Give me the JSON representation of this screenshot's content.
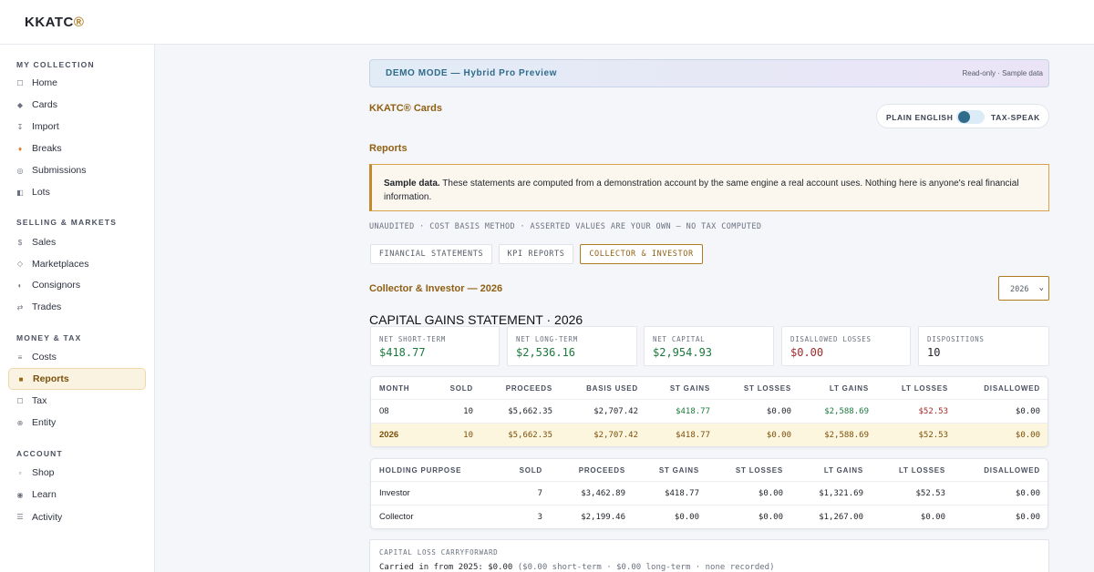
{
  "brand": {
    "name": "KKATC",
    "mark": "®"
  },
  "sidebar": {
    "sections": [
      {
        "title": "MY COLLECTION",
        "items": [
          {
            "label": "Home",
            "icon": "square-outline-icon"
          },
          {
            "label": "Cards",
            "icon": "diamond-icon"
          },
          {
            "label": "Import",
            "icon": "import-icon"
          },
          {
            "label": "Breaks",
            "icon": "flame-icon"
          },
          {
            "label": "Submissions",
            "icon": "target-icon"
          },
          {
            "label": "Lots",
            "icon": "half-square-icon"
          }
        ]
      },
      {
        "title": "SELLING & MARKETS",
        "items": [
          {
            "label": "Sales",
            "icon": "dollar-icon"
          },
          {
            "label": "Marketplaces",
            "icon": "diamond-outline-icon"
          },
          {
            "label": "Consignors",
            "icon": "half-circle-icon"
          },
          {
            "label": "Trades",
            "icon": "swap-icon"
          }
        ]
      },
      {
        "title": "MONEY & TAX",
        "items": [
          {
            "label": "Costs",
            "icon": "lines-icon"
          },
          {
            "label": "Reports",
            "icon": "filled-square-icon",
            "active": true
          },
          {
            "label": "Tax",
            "icon": "box-icon"
          },
          {
            "label": "Entity",
            "icon": "crosshair-icon"
          }
        ]
      },
      {
        "title": "ACCOUNT",
        "items": [
          {
            "label": "Shop",
            "icon": "small-square-icon"
          },
          {
            "label": "Learn",
            "icon": "circle-dot-icon"
          },
          {
            "label": "Activity",
            "icon": "stack-icon"
          }
        ]
      }
    ]
  },
  "demo_banner": {
    "title": "DEMO MODE — Hybrid Pro Preview",
    "right_text": "Read-only · Sample data"
  },
  "brand_title": "KKATC® Cards",
  "toggle": {
    "left_label": "PLAIN ENGLISH",
    "right_label": "TAX-SPEAK",
    "state": "plain-english"
  },
  "reports_title": "Reports",
  "notice": {
    "bold": "Sample data.",
    "text": " These statements are computed from a demonstration account by the same engine a real account uses. Nothing here is anyone's real financial information."
  },
  "methods_line": "UNAUDITED · COST BASIS METHOD · ASSERTED VALUES ARE YOUR OWN — NO TAX COMPUTED",
  "tabs": [
    {
      "label": "FINANCIAL STATEMENTS",
      "active": false
    },
    {
      "label": "KPI REPORTS",
      "active": false
    },
    {
      "label": "COLLECTOR & INVESTOR",
      "active": true
    }
  ],
  "section_title": "Collector & Investor — 2026",
  "year_select": {
    "value": "2026"
  },
  "statement_title": "CAPITAL GAINS STATEMENT · 2026",
  "kpis": [
    {
      "label": "NET SHORT-TERM",
      "value": "$418.77",
      "tone": "gain"
    },
    {
      "label": "NET LONG-TERM",
      "value": "$2,536.16",
      "tone": "gain"
    },
    {
      "label": "NET CAPITAL",
      "value": "$2,954.93",
      "tone": "gain"
    },
    {
      "label": "DISALLOWED LOSSES",
      "value": "$0.00",
      "tone": "loss"
    },
    {
      "label": "DISPOSITIONS",
      "value": "10",
      "tone": "neutral"
    }
  ],
  "monthly_table": {
    "headers": [
      "MONTH",
      "SOLD",
      "PROCEEDS",
      "BASIS USED",
      "ST GAINS",
      "ST LOSSES",
      "LT GAINS",
      "LT LOSSES",
      "DISALLOWED"
    ],
    "rows": [
      [
        "08",
        "10",
        "$5,662.35",
        "$2,707.42",
        "$418.77",
        "$0.00",
        "$2,588.69",
        "$52.53",
        "$0.00"
      ]
    ],
    "total": [
      "2026",
      "10",
      "$5,662.35",
      "$2,707.42",
      "$418.77",
      "$0.00",
      "$2,588.69",
      "$52.53",
      "$0.00"
    ]
  },
  "purpose_table": {
    "headers": [
      "HOLDING PURPOSE",
      "SOLD",
      "PROCEEDS",
      "ST GAINS",
      "ST LOSSES",
      "LT GAINS",
      "LT LOSSES",
      "DISALLOWED"
    ],
    "rows": [
      [
        "Investor",
        "7",
        "$3,462.89",
        "$418.77",
        "$0.00",
        "$1,321.69",
        "$52.53",
        "$0.00"
      ],
      [
        "Collector",
        "3",
        "$2,199.46",
        "$0.00",
        "$0.00",
        "$1,267.00",
        "$0.00",
        "$0.00"
      ]
    ]
  },
  "carryforward": {
    "label": "CAPITAL LOSS CARRYFORWARD",
    "line_main": "Carried in from 2025: $0.00",
    "line_detail": " ($0.00 short-term · $0.00 long-term · none recorded)"
  },
  "colors": {
    "accent": "#b07a1f",
    "gain": "#1b7a3c",
    "loss": "#a12a2a",
    "demo": "#2f6b8a"
  }
}
